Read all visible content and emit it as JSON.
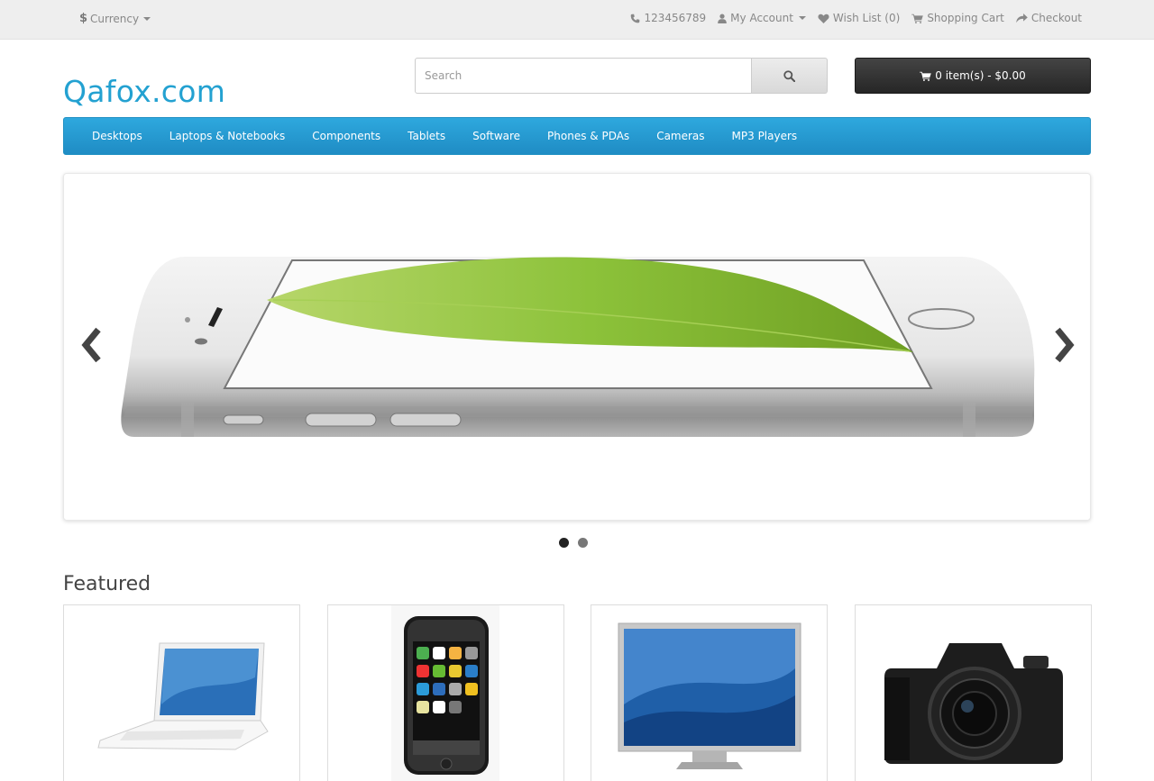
{
  "top_bar": {
    "currency_symbol": "$",
    "currency_label": "Currency",
    "phone": "123456789",
    "my_account": "My Account",
    "wish_list": "Wish List (0)",
    "shopping_cart": "Shopping Cart",
    "checkout": "Checkout"
  },
  "header": {
    "logo": "Qafox.com",
    "search_placeholder": "Search",
    "search_value": "",
    "cart_label": "0 item(s) - $0.00"
  },
  "menu": {
    "items": [
      "Desktops",
      "Laptops & Notebooks",
      "Components",
      "Tablets",
      "Software",
      "Phones & PDAs",
      "Cameras",
      "MP3 Players"
    ]
  },
  "slideshow": {
    "slide_count": 2,
    "active_slide": 1
  },
  "featured": {
    "title": "Featured",
    "products": [
      {
        "image": "white-laptop"
      },
      {
        "image": "iphone"
      },
      {
        "image": "cinema-display"
      },
      {
        "image": "canon-camera"
      }
    ]
  },
  "colors": {
    "brand": "#23a1d1",
    "menu": "#229ac8",
    "cart_button": "#303030",
    "top_bar": "#eeeeee"
  }
}
